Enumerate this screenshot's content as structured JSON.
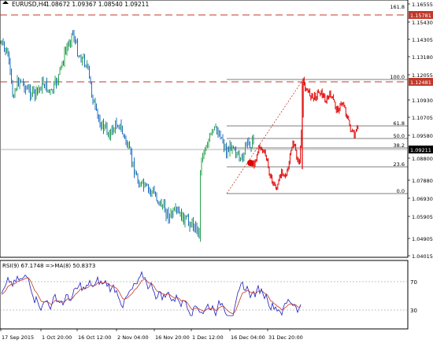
{
  "header": {
    "symbol": "EURUSD,H4",
    "ohlc": "1.08672 1.09367 1.08540 1.09211"
  },
  "colors": {
    "bull": "#2ea44f",
    "bear": "#1f6fbf",
    "projection": "#e00000",
    "fib": "#000000",
    "dash": "#c0392b",
    "rsi": "#1f1fbf",
    "ma": "#c0392b"
  },
  "price_axis": {
    "ticks": [
      "1.16555",
      "1.15430",
      "1.14305",
      "1.13180",
      "1.12055",
      "1.10930",
      "1.10705",
      "1.09580",
      "1.08800",
      "1.07880",
      "1.06930",
      "1.05905",
      "1.04905",
      "1.04015"
    ],
    "current_price": "1.09211",
    "dashed_top_label": "1.15781",
    "dashed_high_label": "1.12481"
  },
  "fib_levels": [
    {
      "pct": "161.8"
    },
    {
      "pct": "100.0"
    },
    {
      "pct": "61.8"
    },
    {
      "pct": "50.0"
    },
    {
      "pct": "38.2"
    },
    {
      "pct": "23.6"
    },
    {
      "pct": "0.0"
    }
  ],
  "rsi": {
    "title": "RSI(9) 67.1748 =>MA(8) 50.8373",
    "levels": [
      "70",
      "30"
    ]
  },
  "time_axis": [
    "17 Sep 2015",
    "1 Oct 20:00",
    "16 Oct 12:00",
    "2 Nov 04:00",
    "16 Nov 20:00",
    "1 Dec 12:00",
    "16 Dec 04:00",
    "31 Dec 20:00"
  ]
}
